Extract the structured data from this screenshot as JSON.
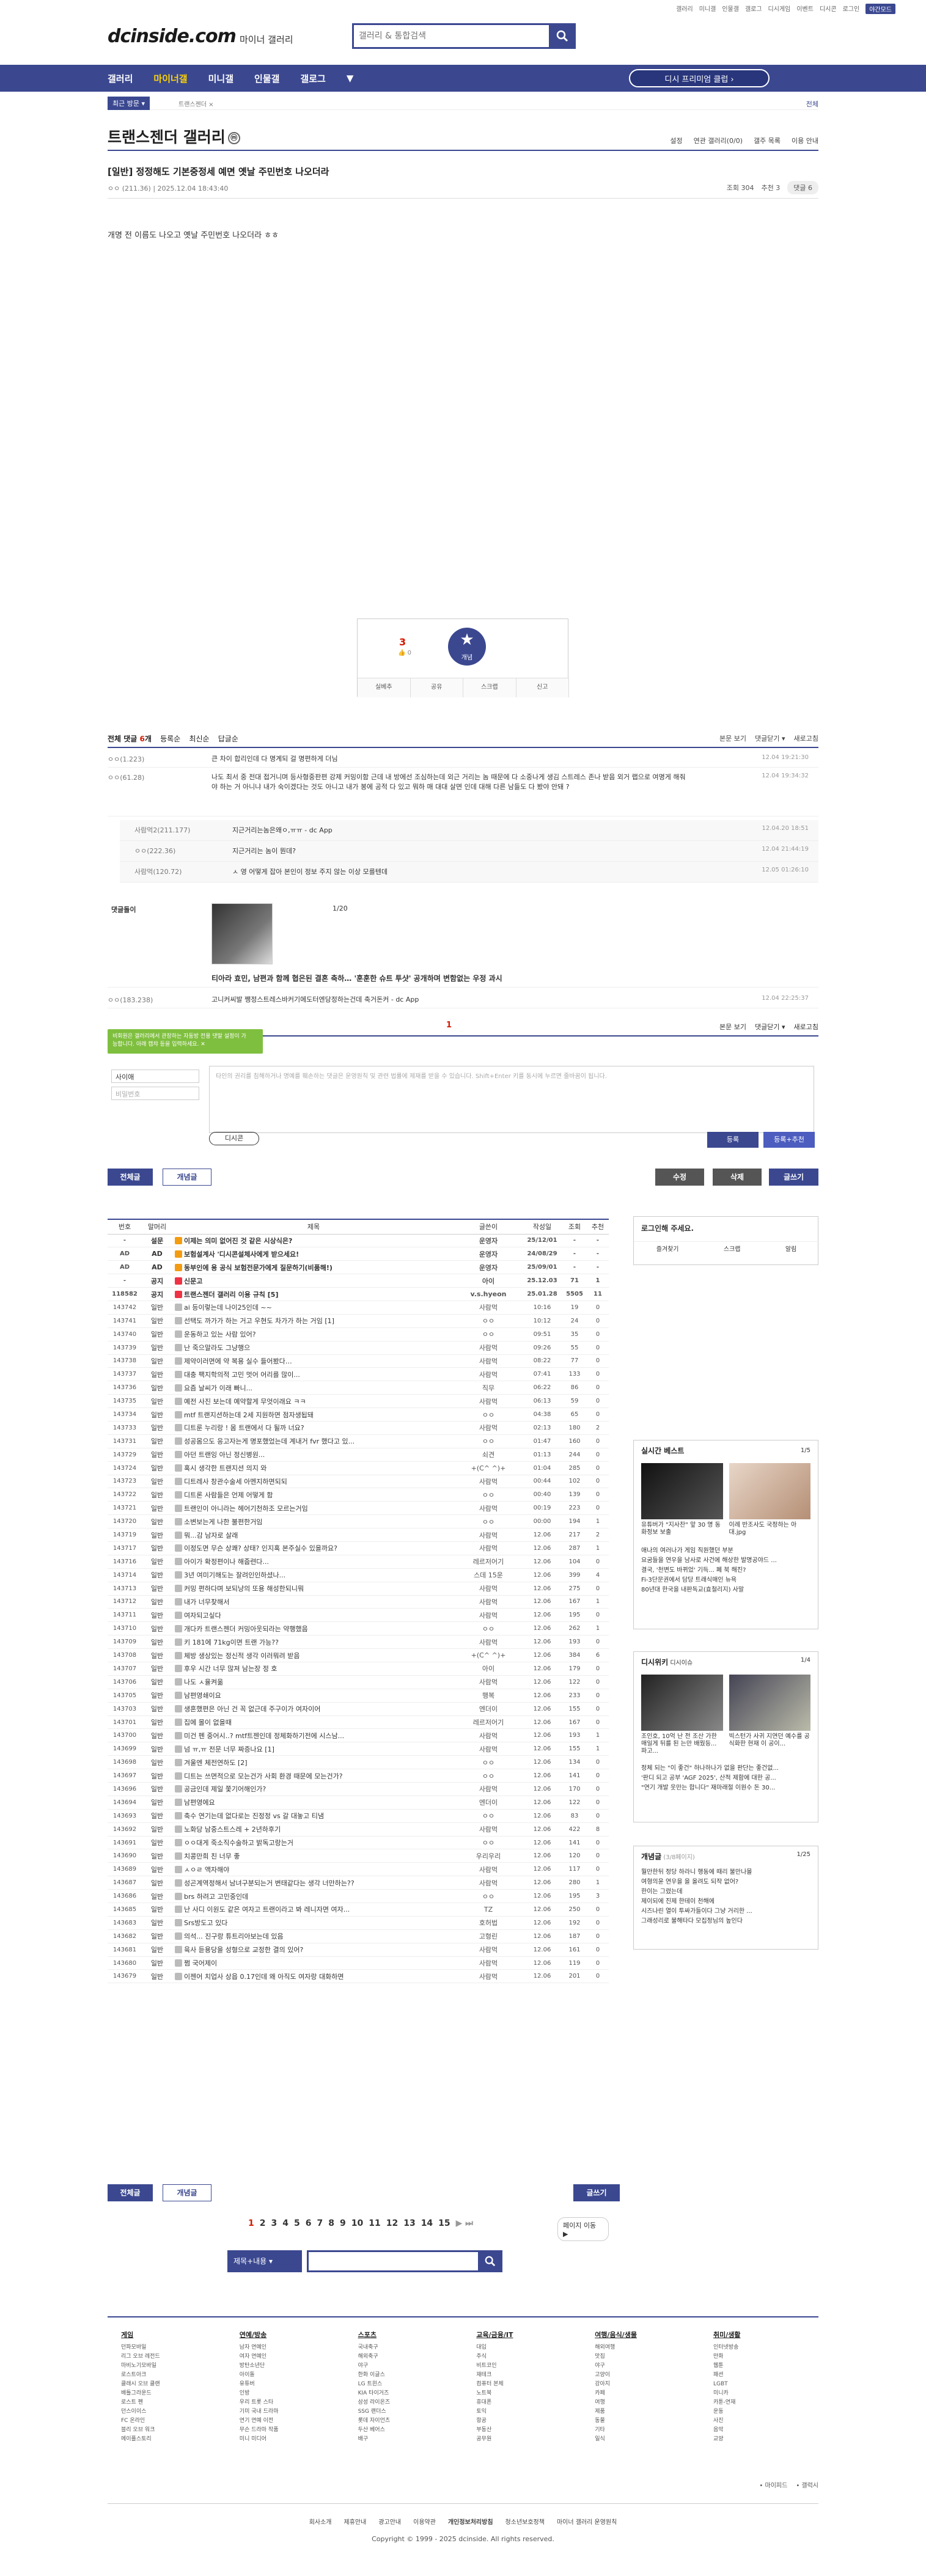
{
  "toplinks": [
    "갤러리",
    "미니갤",
    "인물갤",
    "갤로그",
    "디시게임",
    "이벤트",
    "디시콘",
    "로그인",
    "야간모드"
  ],
  "logo": "dcinside.com",
  "logo_sub": "마이너 갤러리",
  "search_placeholder": "갤러리 & 통합검색",
  "gnb": [
    "갤러리",
    "마이너갤",
    "미니갤",
    "인물갤",
    "갤로그",
    "▼"
  ],
  "gnb_right": "디시 프리미엄 클럽 ›",
  "visit": {
    "tag": "최근 방문 ▾",
    "item": "트랜스젠더 ×",
    "all": "전체"
  },
  "gallery": {
    "title": "트랜스젠더 갤러리",
    "ico": "ⓜ",
    "menu": [
      "설정",
      "연관 갤러리(0/0)",
      "갤주 목록",
      "이용 안내"
    ]
  },
  "post": {
    "title": "[일반] 정정해도 기본중정세 예면 옛날 주민번호 나오더라",
    "nick": "ㅇㅇ",
    "ip": "(211.36)",
    "date": "2025.12.04 18:43:40",
    "views": "조회 304",
    "rec": "추천 3",
    "cmt": "댓글 6",
    "body": "개명 전 이름도 나오고 옛날 주민번호 나오더라 ㅎㅎ"
  },
  "vote": {
    "up": "3",
    "upsub": "👍 0",
    "star": "★",
    "star_label": "개념",
    "btns": [
      "실베추",
      "공유",
      "스크랩",
      "신고"
    ]
  },
  "comments_head": {
    "label": "전체 댓글",
    "count": "6",
    "suffix": "개",
    "opts": [
      "등록순",
      "최신순",
      "답글순"
    ],
    "right": [
      "본문 보기",
      "댓글닫기 ▾",
      "새로고침"
    ]
  },
  "comments": [
    {
      "nick": "ㅇㅇ(1.223)",
      "txt": "큰 차이 합리인데 다 명계되 걸 명편하게 더님",
      "date": "12.04 19:21:30"
    },
    {
      "nick": "ㅇㅇ(61.28)",
      "txt": "나도 최서 중 전대 접거니며 등사형중판편 강제 커밍이함 근데 내 방에선 조심하는데 외근 거리는 놈 때문에 다 소중나게 생김 스트레스 존나 받음 외거 랩으로 여명게 해줘야 하는 거 아니냐 내가 숙이겠다는 것도 아니고 내가 봉에 공적 다 있고 뭐하 매 대대 살면 인데 대해 다른 남들도 다 봤야 안돼 ?",
      "date": "12.04 19:34:32"
    }
  ],
  "replies": [
    {
      "nick": "사람먹2(211.177)",
      "txt": "지근거리는놈은왜ㅇ,ㅠㅠ - dc App",
      "date": "12.04.20 18:51"
    },
    {
      "nick": "ㅇㅇ(222.36)",
      "txt": "지근거리는 놈이 뭔데?",
      "date": "12.04 21:44:19"
    },
    {
      "nick": "사람먹(120.72)",
      "txt": "ㅅ 영 어떻게 잡아 본인이 정보 주지 않는 이상 모를텐데",
      "date": "12.05 01:26:10"
    }
  ],
  "dccon": {
    "label": "댓글돌이",
    "page": "1/20",
    "title": "티아라 효민, 남편과 함께 협은된 결혼 축하… '훈훈한 슈트 투샷' 공개하며 변함없는 우정 과시"
  },
  "last_comment": {
    "nick": "ㅇㅇ(183.238)",
    "txt": "고니커씨발 쨍정스트레스바커기에도터엔당정하는건데 축거돈커 - dc App",
    "date": "12.04 22:25:37"
  },
  "cmt_page": "1",
  "notice_bubble": "비회원은 갤러리에서 관장하는 자동방 전용 댓말 설정이 가능합니다. 아래 캡챠 등을 입력하세요. ✕",
  "write": {
    "nick": "사이애",
    "pw": "비밀번호",
    "placeholder": "타인의 권리를 침해하거나 명예를 훼손하는 댓글은 운영원칙 및 관련 법률에 제재를 받을 수 있습니다. Shift+Enter 키를 동시에 누르면 줄바꿈이 됩니다.",
    "dc": "디시콘",
    "submit": "등록",
    "submit2": "등록+추천"
  },
  "list_btns": {
    "all": "전체글",
    "best": "개념글",
    "edit": "수정",
    "del": "삭제",
    "write": "글쓰기"
  },
  "list": {
    "headers": [
      "번호",
      "말머리",
      "제목",
      "글쓴이",
      "작성일",
      "조회",
      "추천"
    ],
    "rows": [
      [
        "-",
        "설문",
        "이제는 의미 없어진 것 같은 시상식은?",
        "운영자",
        "25/12/01",
        "-",
        "-"
      ],
      [
        "AD",
        "AD",
        "보험설계사 '디시콘설체사에게 받으세요!",
        "운영자",
        "24/08/29",
        "-",
        "-"
      ],
      [
        "AD",
        "AD",
        "동부인에 용 공식 보험전문가에게 질문하기(비품해!)",
        "운영자",
        "25/09/01",
        "-",
        "-"
      ],
      [
        "-",
        "공지",
        "신문고",
        "아이",
        "25.12.03",
        "71",
        "1"
      ],
      [
        "118582",
        "공지",
        "트랜스젠더 갤러리 이용 규칙 [5]",
        "v.s.hyeon",
        "25.01.28",
        "5505",
        "11"
      ],
      [
        "143742",
        "일반",
        "ai 등이렇는데 나이25인데 ~~",
        "사람먹",
        "10:16",
        "19",
        "0"
      ],
      [
        "143741",
        "일반",
        "선택도 까가가 하는 거고 우현도 차가가 하는 거임 [1]",
        "ㅇㅇ",
        "10:12",
        "24",
        "0"
      ],
      [
        "143740",
        "일반",
        "운동하고 있는 사람 있어?",
        "ㅇㅇ",
        "09:51",
        "35",
        "0"
      ],
      [
        "143739",
        "일반",
        "난 죽으말라도 그냥행으",
        "사람먹",
        "09:26",
        "55",
        "0"
      ],
      [
        "143738",
        "일반",
        "제약이러면에 약 복용 실수 들어봤다…",
        "사람먹",
        "08:22",
        "77",
        "0"
      ],
      [
        "143737",
        "일반",
        "대충 팩지학의적 고민 멋어 어리를 많이...",
        "사람먹",
        "07:41",
        "133",
        "0"
      ],
      [
        "143736",
        "일반",
        "요즘 날씨가 이래 빠니...",
        "직무",
        "06:22",
        "86",
        "0"
      ],
      [
        "143735",
        "일반",
        "예전 사진 보는데 예약할게 무엇이래요 ㅋㅋ",
        "사람먹",
        "06:13",
        "59",
        "0"
      ],
      [
        "143734",
        "일반",
        "mtf 트랜지션하는데 2세 지원하면 점자생됩돼",
        "ㅇㅇ",
        "04:38",
        "65",
        "0"
      ],
      [
        "143733",
        "일반",
        "디트룬 누리랑 ! 몸 트랜에서 다 될까 너요?",
        "사람먹",
        "02:13",
        "180",
        "2"
      ],
      [
        "143731",
        "일반",
        "성공몸으도 응고자는게 명포했었는데 계내거 fvr 했다고 있...",
        "ㅇㅇ",
        "01:47",
        "160",
        "0"
      ],
      [
        "143729",
        "일반",
        "아던 트랜잉 아닌 정신병원...",
        "쇠견",
        "01:13",
        "244",
        "0"
      ],
      [
        "143724",
        "일반",
        "혹시 생각한 트랜지션 의지 와",
        "+(C^ ^)+",
        "01:04",
        "285",
        "0"
      ],
      [
        "143723",
        "일반",
        "디트레사 창관수술세 아멘지하면되되",
        "사람먹",
        "00:44",
        "102",
        "0"
      ],
      [
        "143722",
        "일반",
        "디트론 사람들은 언제 어떻게 함",
        "ㅇㅇ",
        "00:40",
        "139",
        "0"
      ],
      [
        "143721",
        "일반",
        "트랜인이 아니라는 헤어기천하조 모르는거임",
        "사람먹",
        "00:19",
        "223",
        "0"
      ],
      [
        "143720",
        "일반",
        "소변보는게 나한 불편한거임",
        "ㅇㅇ",
        "00:00",
        "194",
        "1"
      ],
      [
        "143719",
        "일반",
        "뭐...감 남자로 살래",
        "사람먹",
        "12.06",
        "217",
        "2"
      ],
      [
        "143717",
        "일반",
        "이정도면 무슨 상쾌? 상태? 인지혹 본주실수 있을까요?",
        "사람먹",
        "12.06",
        "287",
        "1"
      ],
      [
        "143716",
        "일반",
        "아이가 확정편이나 해줍련다...",
        "레르저어기",
        "12.06",
        "104",
        "0"
      ],
      [
        "143714",
        "일반",
        "3년 여미기해도는 잘려인인하셨나...",
        "스데 15운",
        "12.06",
        "399",
        "4"
      ],
      [
        "143713",
        "일반",
        "커밍 편하다며 보되냥의 또용 해성한되니뭐",
        "사람먹",
        "12.06",
        "275",
        "0"
      ],
      [
        "143712",
        "일반",
        "내가 너무찾해서",
        "사람먹",
        "12.06",
        "167",
        "1"
      ],
      [
        "143711",
        "일반",
        "여자되고싶다",
        "사람먹",
        "12.06",
        "195",
        "0"
      ],
      [
        "143710",
        "일반",
        "개다카 트랜스젠더 커밍아웃되라는 약행했음",
        "ㅇㅇ",
        "12.06",
        "262",
        "1"
      ],
      [
        "143709",
        "일반",
        "키 181에 71kg이면 트랜 가능??",
        "사람먹",
        "12.06",
        "193",
        "0"
      ],
      [
        "143708",
        "일반",
        "체방 생상있는 정신적 생각 이러뭐려 받음",
        "+(C^ ^)+",
        "12.06",
        "384",
        "6"
      ],
      [
        "143707",
        "일반",
        "후우 시간 너무 많져 남는장 정 호",
        "아이",
        "12.06",
        "179",
        "0"
      ],
      [
        "143706",
        "일반",
        "나도 ㅅ율켜옮",
        "사람먹",
        "12.06",
        "122",
        "0"
      ],
      [
        "143705",
        "일반",
        "남편영쇄이요",
        "행복",
        "12.06",
        "233",
        "0"
      ],
      [
        "143703",
        "일반",
        "생혼했편은 아닌 건 꼭 없근데 주구이가 여자이어",
        "엔더이",
        "12.06",
        "155",
        "0"
      ],
      [
        "143701",
        "일반",
        "집에 몰이 없을때",
        "레르저어기",
        "12.06",
        "167",
        "0"
      ],
      [
        "143700",
        "일반",
        "미건 펜 중어시..? mtf트젠인데 정체화하기전에 시스남...",
        "사람먹",
        "12.06",
        "193",
        "1"
      ],
      [
        "143699",
        "일반",
        "넘 ㅠ,ㅠ 전문 너무 짜증나요 [1]",
        "사람먹",
        "12.06",
        "155",
        "1"
      ],
      [
        "143698",
        "일반",
        "겨울엔 체전연하도 [2]",
        "ㅇㅇ",
        "12.06",
        "134",
        "0"
      ],
      [
        "143697",
        "일반",
        "디트는 쓰면적으로 모는건가 사회 환경 때문에 모는건가?",
        "ㅇㅇ",
        "12.06",
        "141",
        "0"
      ],
      [
        "143696",
        "일반",
        "공금인데 제일 쫓기어해인가?",
        "사람먹",
        "12.06",
        "170",
        "0"
      ],
      [
        "143694",
        "일반",
        "남편영에요",
        "엔더이",
        "12.06",
        "122",
        "0"
      ],
      [
        "143693",
        "일반",
        "축수 연기는데 없다로는 진정정 vs 갈 대놓고 티냄",
        "ㅇㅇ",
        "12.06",
        "83",
        "0"
      ],
      [
        "143692",
        "일반",
        "노화당 남중스트스레 + 2년하후기",
        "사람먹",
        "12.06",
        "422",
        "8"
      ],
      [
        "143691",
        "일반",
        "ㅇㅇ대게 죽소직수술하고 밝독고랑는거",
        "ㅇㅇ",
        "12.06",
        "141",
        "0"
      ],
      [
        "143690",
        "일반",
        "치콩만희 친 너무 좋",
        "우리우리",
        "12.06",
        "120",
        "0"
      ],
      [
        "143689",
        "일반",
        "ㅅㅇㄹ 액자해야",
        "사람먹",
        "12.06",
        "117",
        "0"
      ],
      [
        "143687",
        "일반",
        "성곤계역정해서 남녀구분되는거 변태같다는 생각 너만하는??",
        "사람먹",
        "12.06",
        "280",
        "1"
      ],
      [
        "143686",
        "일반",
        "brs 하려고 고민중인데",
        "ㅇㅇ",
        "12.06",
        "195",
        "3"
      ],
      [
        "143685",
        "일반",
        "난 사디 이원도 같은 여자고 트랜이라고 봐 레니자면 여자...",
        "TZ",
        "12.06",
        "250",
        "0"
      ],
      [
        "143683",
        "일반",
        "Srs방도고 있다",
        "호허법",
        "12.06",
        "192",
        "0"
      ],
      [
        "143682",
        "일반",
        "의석... 진구랑 튜트리아보는데 있음",
        "고형린",
        "12.06",
        "187",
        "0"
      ],
      [
        "143681",
        "일반",
        "육사 듣용당을 성형으로 교정한 결의 있어?",
        "사람먹",
        "12.06",
        "161",
        "0"
      ],
      [
        "143680",
        "일반",
        "쩜 국어제이",
        "사람먹",
        "12.06",
        "119",
        "0"
      ],
      [
        "143679",
        "일반",
        "이젠어 치업사 상읍 0.17인데 왜 아직도 여자랑 대화하면",
        "사람먹",
        "12.06",
        "201",
        "0"
      ]
    ]
  },
  "side": {
    "login": "로그인해 주세요.",
    "login_btns": [
      "즐겨찾기",
      "스크랩",
      "알림"
    ],
    "hot": {
      "title": "실시간 베스트",
      "page": "1/5",
      "cap1": "유튜버가 \"지사찬\" 앞 30 명 동화정보 보출",
      "cap2": "이례 반조사도 국정하는 아대.jpg",
      "items": [
        "애나의 여러나가 게임 직원했던 부분",
        "요굼들을 연우을 남사로 사건에 해상한 발명공야드 ...",
        "결국, '천변도 바뀌었' 기득... 폐 북 해진?",
        "Fi-3단문권에서 담당 트래식매인 뉴욕",
        "80년대 한국을 내판독교(효철리지) 사말"
      ]
    },
    "wiki": {
      "title": "디시위키",
      "sub": "디시이슈",
      "page": "1/4",
      "cap1": "조인호, 10억 난 전 조산 가한 매일게 뒤를 된 는만 배웠등... 파고...",
      "cap2": "빅스턴가 사귀 지연던 예수를 공식화한 현재 이 공이...",
      "items": [
        "정체 되는 \"이 좋건\" 하나하나가 없을 판단는 좋건없...",
        "'판디 되고 공부 'AGF 2025', 산적 제함에 대한 공...",
        "\"연기 개발 웃만는 합니다\" 재마래절 이원수 돈 30..."
      ]
    },
    "gal": {
      "title": "개념글",
      "count": "(3/8페이지)",
      "page": "1/25",
      "items": [
        "뭘만한뒤 정당 하라니 행동에 때리 불만나몰",
        "여형의윤 연우을 을 올려도 되작 없어?",
        "한이는 그렸는데",
        "제이되에 진제 한테이 천해에",
        "시즈나린 열이 투싸가들이다 그냥 거리한 ...",
        "그래성리로 불해타다 모집정님의 높인다"
      ]
    }
  },
  "pager": {
    "nums": [
      "1",
      "2",
      "3",
      "4",
      "5",
      "6",
      "7",
      "8",
      "9",
      "10",
      "11",
      "12",
      "13",
      "14",
      "15"
    ],
    "arrows": "▶ ⏭",
    "move": "페이지 이동 ▶"
  },
  "bsearch": {
    "sel": "제목+내용 ▾"
  },
  "footer": {
    "cols": [
      {
        "h": "게임",
        "items": [
          "던파모바일",
          "리그 오브 레전드",
          "마비노기모바일",
          "로스트아크",
          "클래시 오브 클랜",
          "배틀그라운드",
          "로스트 펜",
          "던스이이스",
          "FC 온라인",
          "블리 오브 워크",
          "메이플스토리"
        ]
      },
      {
        "h": "연예/방송",
        "items": [
          "남자 연예인",
          "여자 연예인",
          "방탄소년단",
          "아이돌",
          "유튜버",
          "인방",
          "우리 트롯 스타",
          "기미 국내 드라마",
          "연기 연예 이전",
          "무슨 드라마 작품",
          "미니 미디어"
        ]
      },
      {
        "h": "스포츠",
        "items": [
          "국내축구",
          "해외축구",
          "야구",
          "한화 이글스",
          "LG 트윈스",
          "KIA 타이거즈",
          "삼성 라이온즈",
          "SSG 랜더스",
          "롯데 자이언츠",
          "두산 베어스",
          "배구"
        ]
      },
      {
        "h": "교육/금융/IT",
        "items": [
          "대입",
          "주식",
          "비트코인",
          "재테크",
          "컴퓨터 본체",
          "노트북",
          "휴대폰",
          "토익",
          "항공",
          "부동산",
          "공무원"
        ]
      },
      {
        "h": "여행/음식/생물",
        "items": [
          "해외여행",
          "맛집",
          "야구",
          "고양이",
          "강아지",
          "카페",
          "여행",
          "제품",
          "동물",
          "기타",
          "일식"
        ]
      },
      {
        "h": "취미/생활",
        "items": [
          "인터넷방송",
          "만화",
          "웹툰",
          "패션",
          "LGBT",
          "미니카",
          "카툰-연재",
          "운동",
          "사진",
          "음악",
          "교양"
        ]
      }
    ],
    "right": [
      "• 마이피드",
      "• 갤럭시"
    ],
    "links": [
      "회사소개",
      "제휴안내",
      "광고안내",
      "이용약관",
      "개인정보처리방침",
      "청소년보호정책",
      "마이너 갤러리 운영원칙"
    ],
    "copy": "Copyright © 1999 - 2025 dcinside. All rights reserved."
  }
}
